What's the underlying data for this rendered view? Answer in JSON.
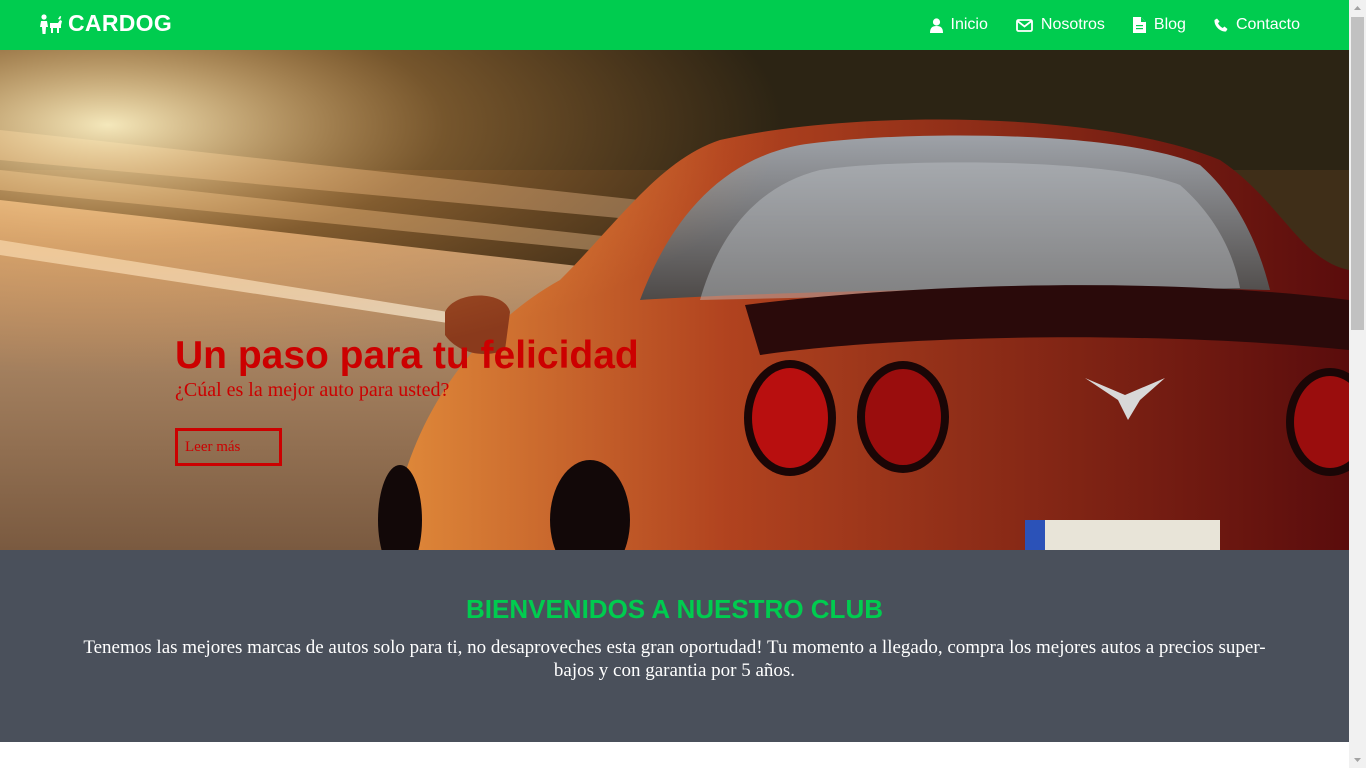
{
  "navbar": {
    "brand": "CARDOG",
    "brand_icon": "dog-person-icon",
    "items": [
      {
        "label": "Inicio",
        "icon": "user-icon"
      },
      {
        "label": "Nosotros",
        "icon": "envelope-icon"
      },
      {
        "label": "Blog",
        "icon": "document-icon"
      },
      {
        "label": "Contacto",
        "icon": "phone-icon"
      }
    ]
  },
  "hero": {
    "title": "Un paso para tu felicidad",
    "subtitle": "¿Cúal es la mejor auto para usted?",
    "button": "Leer más"
  },
  "welcome": {
    "title": "BIENVENIDOS A NUESTRO CLUB",
    "text": "Tenemos las mejores marcas de autos solo para ti, no desaproveches esta gran oportudad! Tu momento a llegado, compra los mejores autos a precios super-bajos y con garantia por 5 años."
  },
  "colors": {
    "nav_green": "#00cc4f",
    "hero_red": "#cc0000",
    "welcome_bg": "#4a505b",
    "welcome_title": "#00cc4f"
  }
}
